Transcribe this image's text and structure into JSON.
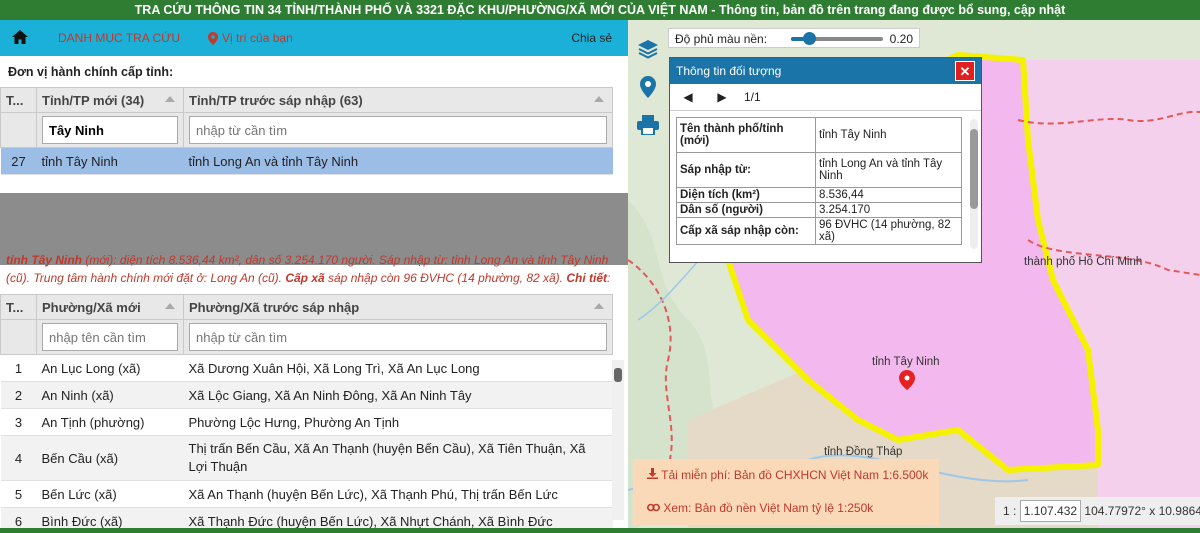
{
  "header": {
    "title": "TRA CỨU THÔNG TIN 34 TỈNH/THÀNH PHỐ VÀ 3321 ĐẶC KHU/PHƯỜNG/XÃ MỚI CỦA VIỆT NAM",
    "subtitle": " - Thông tin, bản đồ trên trang đang được bổ sung, cập nhật"
  },
  "nav": {
    "home_icon": "home-icon",
    "catalog": "DANH MỤC TRA CỨU",
    "location": "Vị trí của bạn",
    "share": "Chia sẻ"
  },
  "province_section": {
    "label": "Đơn vị hành chính cấp tỉnh:",
    "columns": [
      "T...",
      "Tỉnh/TP mới (34)",
      "Tỉnh/TP trước sáp nhập (63)"
    ],
    "filter_value": "Tây Ninh",
    "filter_placeholder": "nhập từ cần tìm",
    "rows": [
      {
        "id": "27",
        "new": "tỉnh Tây Ninh",
        "old": "tỉnh Long An và tỉnh Tây Ninh"
      }
    ]
  },
  "summary": {
    "name": "tỉnh Tây Ninh",
    "text1": " (mới): diện tích 8.536,44 km², dân số 3.254.170 người. Sáp nhập từ: tỉnh Long An và tỉnh Tây Ninh (cũ). Trung tâm hành chính mới đặt ở: Long An (cũ). ",
    "label2": "Cấp xã",
    "text2": " sáp nhập còn 96 ĐVHC (14 phường, 82 xã). ",
    "label3": "Chi tiết",
    "text3": ":"
  },
  "ward_section": {
    "columns": [
      "T...",
      "Phường/Xã mới",
      "Phường/Xã trước sáp nhập"
    ],
    "filter_new_placeholder": "nhập tên cần tìm",
    "filter_old_placeholder": "nhập từ cần tìm",
    "rows": [
      {
        "id": "1",
        "new": "An Lục Long (xã)",
        "old": "Xã Dương Xuân Hội, Xã Long Trì, Xã An Lục Long"
      },
      {
        "id": "2",
        "new": "An Ninh (xã)",
        "old": "Xã Lộc Giang, Xã An Ninh Đông, Xã An Ninh Tây"
      },
      {
        "id": "3",
        "new": "An Tịnh (phường)",
        "old": "Phường Lộc Hưng, Phường An Tịnh"
      },
      {
        "id": "4",
        "new": "Bến Cầu (xã)",
        "old": "Thị trấn Bến Cầu, Xã An Thạnh (huyện Bến Cầu), Xã Tiên Thuận, Xã Lợi Thuận"
      },
      {
        "id": "5",
        "new": "Bến Lức (xã)",
        "old": "Xã An Thạnh (huyện Bến Lức), Xã Thạnh Phú, Thị trấn Bến Lức"
      },
      {
        "id": "6",
        "new": "Bình Đức (xã)",
        "old": "Xã Thạnh Đức (huyện Bến Lức), Xã Nhựt Chánh, Xã Bình Đức"
      }
    ]
  },
  "map": {
    "opacity_label": "Độ phủ màu nền:",
    "opacity_value": "0.20",
    "opacity_level": 0.2,
    "labels": {
      "tay_ninh": "tỉnh Tây Ninh",
      "hcm": "thành phố Hồ Chí Minh",
      "dong_thap": "tỉnh Đồng Tháp"
    },
    "popup": {
      "title": "Thông tin đối tượng",
      "page": "1/1",
      "rows": [
        {
          "k": "Tên thành phố/tỉnh (mới)",
          "v": "tỉnh Tây Ninh"
        },
        {
          "k": "Sáp nhập từ:",
          "v": "tỉnh Long An và tỉnh Tây Ninh"
        },
        {
          "k": "Diện tích (km²)",
          "v": "8.536,44"
        },
        {
          "k": "Dân số (người)",
          "v": "3.254.170"
        },
        {
          "k": "Cấp xã sáp nhập còn:",
          "v": "96 ĐVHC (14 phường, 82 xã)"
        }
      ]
    },
    "download1": "Tải miễn phí: Bản đồ CHXHCN Việt Nam 1:6.500k",
    "download2": "Xem: Bản đồ nền Việt Nam tỷ lệ 1:250k",
    "scale_prefix": "1 :",
    "scale_value": "1.107.432",
    "coords": "104.77972° x 10.9864"
  },
  "colors": {
    "header_green": "#2e7d32",
    "nav_blue": "#1ab0d8",
    "selected_row": "#9bbde6",
    "province_fill": "#f3b8ee",
    "boundary_yellow": "#f5f200",
    "popup_header": "#1a74a8"
  }
}
